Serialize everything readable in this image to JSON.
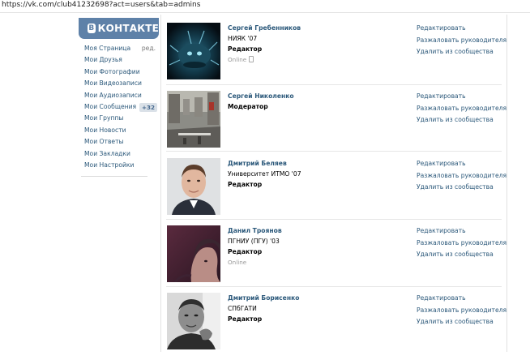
{
  "browser": {
    "url": "https://vk.com/club41232698?act=users&tab=admins"
  },
  "logo": {
    "icon_letter": "B",
    "text": "КОНТАКТЕ"
  },
  "sidebar": {
    "items": [
      {
        "label": "Моя Страница",
        "edit": "ред."
      },
      {
        "label": "Мои Друзья"
      },
      {
        "label": "Мои Фотографии"
      },
      {
        "label": "Мои Видеозаписи"
      },
      {
        "label": "Мои Аудиозаписи"
      },
      {
        "label": "Мои Сообщения",
        "badge": "+32"
      },
      {
        "label": "Мои Группы"
      },
      {
        "label": "Мои Новости"
      },
      {
        "label": "Мои Ответы"
      },
      {
        "label": "Мои Закладки"
      },
      {
        "label": "Мои Настройки"
      }
    ]
  },
  "actions": {
    "edit": "Редактировать",
    "demote": "Разжаловать руководителя",
    "remove": "Удалить из сообщества"
  },
  "admins": [
    {
      "name": "Сергей Гребенников",
      "sub": "НИЯК '07",
      "role": "Редактор",
      "online": "Online"
    },
    {
      "name": "Сергей Николенко",
      "sub": "",
      "role": "Модератор",
      "online": ""
    },
    {
      "name": "Дмитрий Беляев",
      "sub": "Университет ИТМО '07",
      "role": "Редактор",
      "online": ""
    },
    {
      "name": "Данил Троянов",
      "sub": "ПГНИУ (ПГУ) '03",
      "role": "Редактор",
      "online": "Online"
    },
    {
      "name": "Дмитрий Борисенко",
      "sub": "СПбГАТИ",
      "role": "Редактор",
      "online": ""
    }
  ],
  "colors": {
    "brand": "#5e81a8",
    "link": "#2b587a",
    "muted": "#999999"
  }
}
